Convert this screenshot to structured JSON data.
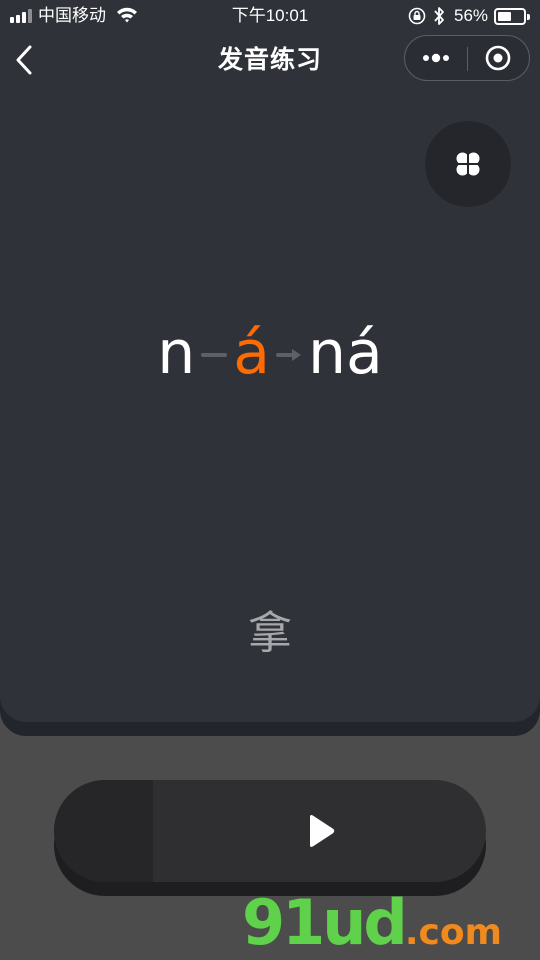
{
  "status_bar": {
    "carrier": "中国移动",
    "time": "下午10:01",
    "battery_percent": "56%",
    "battery_level": 0.56,
    "icons": [
      "signal-icon",
      "wifi-icon",
      "rotation-lock-icon",
      "bluetooth-icon",
      "battery-icon"
    ]
  },
  "nav": {
    "title": "发音练习",
    "back_icon": "chevron-left-icon",
    "more_icon": "more-dots-icon",
    "close_icon": "target-close-icon"
  },
  "menu_button": {
    "icon": "four-petal-grid-icon"
  },
  "pinyin": {
    "initial": "n",
    "final": "á",
    "syllable": "ná",
    "connector_icons": [
      "dash-icon",
      "arrow-right-icon"
    ]
  },
  "character": "拿",
  "player": {
    "icon": "play-icon",
    "progress": 0.23
  },
  "watermark": {
    "main": "91ud",
    "tld": ".com"
  },
  "colors": {
    "background": "#4c4c4c",
    "panel": "#30323a",
    "accent": "#ff6b00",
    "hanzi": "#a7a8ac",
    "watermark_green": "#5fd14a",
    "watermark_orange": "#f08a1e"
  }
}
